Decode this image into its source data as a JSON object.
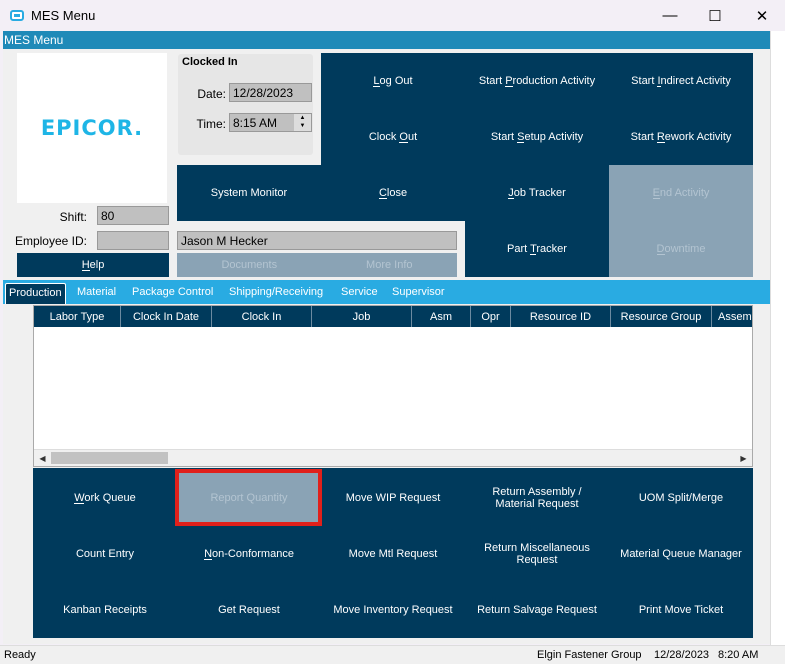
{
  "window": {
    "title": "MES Menu",
    "minimize": "—",
    "maximize": "☐",
    "close": "✕"
  },
  "menu_band": "MES Menu",
  "logo": "EPICOR.",
  "clocked_in": {
    "heading": "Clocked In",
    "date_label": "Date:",
    "date": "12/28/2023",
    "time_label": "Time:",
    "time": "8:15 AM"
  },
  "employee": {
    "shift_label": "Shift:",
    "shift": "80",
    "id_label": "Employee ID:",
    "id": "",
    "name": "Jason M Hecker"
  },
  "buttons": {
    "log_out": {
      "label": "Log Out",
      "ul": 0
    },
    "start_production": {
      "label": "Start Production Activity",
      "ul": 6
    },
    "start_indirect": {
      "label": "Start Indirect Activity",
      "ul": 6
    },
    "clock_out": {
      "label": "Clock Out",
      "ul": 6
    },
    "start_setup": {
      "label": "Start Setup Activity",
      "ul": 6
    },
    "start_rework": {
      "label": "Start Rework Activity",
      "ul": 6
    },
    "system_monitor": {
      "label": "System Monitor",
      "ul": -1
    },
    "close": {
      "label": "Close",
      "ul": 0
    },
    "job_tracker": {
      "label": "Job Tracker",
      "ul": 0
    },
    "end_activity": {
      "label": "End Activity",
      "ul": 0
    },
    "part_tracker": {
      "label": "Part Tracker",
      "ul": 5
    },
    "downtime": {
      "label": "Downtime",
      "ul": 0
    },
    "help": {
      "label": "Help",
      "ul": 0
    },
    "documents": {
      "label": "Documents",
      "ul": -1
    },
    "more_info": {
      "label": "More Info",
      "ul": -1
    }
  },
  "tabs": [
    "Production",
    "Material",
    "Package Control",
    "Shipping/Receiving",
    "Service",
    "Supervisor"
  ],
  "grid": {
    "columns": [
      "Labor Type",
      "Clock In Date",
      "Clock In",
      "Job",
      "Asm",
      "Opr",
      "Resource ID",
      "Resource Group",
      "Assembly"
    ],
    "rows": []
  },
  "actions": [
    {
      "label": "Work Queue",
      "ul": 0
    },
    {
      "label": "Report Quantity",
      "ul": -1
    },
    {
      "label": "Move WIP Request",
      "ul": -1
    },
    {
      "label": "Return Assembly / Material Request",
      "ul": -1
    },
    {
      "label": "UOM Split/Merge",
      "ul": -1
    },
    {
      "label": "Count Entry",
      "ul": -1
    },
    {
      "label": "Non-Conformance",
      "ul": 0
    },
    {
      "label": "Move Mtl Request",
      "ul": -1
    },
    {
      "label": "Return Miscellaneous Request",
      "ul": -1
    },
    {
      "label": "Material Queue Manager",
      "ul": -1
    },
    {
      "label": "Kanban Receipts",
      "ul": -1
    },
    {
      "label": "Get Request",
      "ul": -1
    },
    {
      "label": "Move Inventory Request",
      "ul": -1
    },
    {
      "label": "Return Salvage Request",
      "ul": -1
    },
    {
      "label": "Print Move Ticket",
      "ul": -1
    }
  ],
  "status": {
    "left": "Ready",
    "company": "Elgin Fastener Group",
    "date": "12/28/2023",
    "time": "8:20 AM"
  },
  "colors": {
    "navy": "#003a5c",
    "tab_bar": "#29abe2",
    "highlight": "#e0201b"
  }
}
